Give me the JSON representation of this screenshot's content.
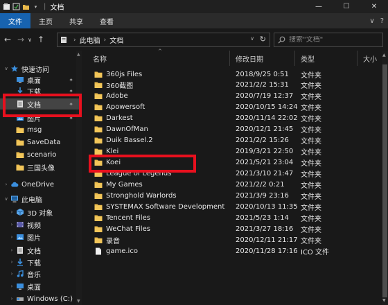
{
  "titlebar": {
    "title": "文档",
    "separator": "|",
    "controls": {
      "minimize": "—",
      "maximize": "☐",
      "close": "✕"
    }
  },
  "ribbon": {
    "tabs": [
      {
        "label": "文件",
        "active": true
      },
      {
        "label": "主页",
        "active": false
      },
      {
        "label": "共享",
        "active": false
      },
      {
        "label": "查看",
        "active": false
      }
    ],
    "expand_glyph": "∨",
    "help_glyph": "?"
  },
  "nav": {
    "back": "←",
    "forward": "→",
    "recent": "∨",
    "up": "↑",
    "breadcrumb": [
      "此电脑",
      "文档"
    ],
    "crumb_sep": "›",
    "dropdown": "∨",
    "refresh": "↻"
  },
  "search": {
    "placeholder": "搜索\"文档\""
  },
  "sidebar": {
    "items": [
      {
        "label": "快速访问",
        "icon": "star-icon",
        "chevron": "∨",
        "indent": 0,
        "pinned": false,
        "selected": false
      },
      {
        "label": "桌面",
        "icon": "desktop-icon",
        "chevron": "",
        "indent": 1,
        "pinned": true,
        "selected": false
      },
      {
        "label": "下载",
        "icon": "download-icon",
        "chevron": "",
        "indent": 1,
        "pinned": true,
        "selected": false
      },
      {
        "label": "文档",
        "icon": "document-icon",
        "chevron": "",
        "indent": 1,
        "pinned": true,
        "selected": true
      },
      {
        "label": "图片",
        "icon": "pictures-icon",
        "chevron": "",
        "indent": 1,
        "pinned": true,
        "selected": false
      },
      {
        "label": "msg",
        "icon": "folder-icon",
        "chevron": "",
        "indent": 1,
        "pinned": false,
        "selected": false
      },
      {
        "label": "SaveData",
        "icon": "folder-icon",
        "chevron": "",
        "indent": 1,
        "pinned": false,
        "selected": false
      },
      {
        "label": "scenario",
        "icon": "folder-icon",
        "chevron": "",
        "indent": 1,
        "pinned": false,
        "selected": false
      },
      {
        "label": "三国头像",
        "icon": "folder-icon",
        "chevron": "",
        "indent": 1,
        "pinned": false,
        "selected": false
      },
      {
        "label": "OneDrive",
        "icon": "cloud-icon",
        "chevron": "›",
        "indent": 0,
        "pinned": false,
        "selected": false
      },
      {
        "label": "此电脑",
        "icon": "computer-icon",
        "chevron": "∨",
        "indent": 0,
        "pinned": false,
        "selected": false
      },
      {
        "label": "3D 对象",
        "icon": "cube-icon",
        "chevron": "›",
        "indent": 1,
        "pinned": false,
        "selected": false
      },
      {
        "label": "视频",
        "icon": "video-icon",
        "chevron": "›",
        "indent": 1,
        "pinned": false,
        "selected": false
      },
      {
        "label": "图片",
        "icon": "pictures-icon",
        "chevron": "›",
        "indent": 1,
        "pinned": false,
        "selected": false
      },
      {
        "label": "文档",
        "icon": "document-icon",
        "chevron": "›",
        "indent": 1,
        "pinned": false,
        "selected": false
      },
      {
        "label": "下载",
        "icon": "download-icon",
        "chevron": "›",
        "indent": 1,
        "pinned": false,
        "selected": false
      },
      {
        "label": "音乐",
        "icon": "music-icon",
        "chevron": "›",
        "indent": 1,
        "pinned": false,
        "selected": false
      },
      {
        "label": "桌面",
        "icon": "desktop-icon",
        "chevron": "›",
        "indent": 1,
        "pinned": false,
        "selected": false
      },
      {
        "label": "Windows (C:)",
        "icon": "drive-icon",
        "chevron": "›",
        "indent": 1,
        "pinned": false,
        "selected": false
      }
    ]
  },
  "columns": {
    "name": "名称",
    "date": "修改日期",
    "type": "类型",
    "size": "大小"
  },
  "files": [
    {
      "name": "360js Files",
      "date": "2018/9/25 0:51",
      "type": "文件夹",
      "icon": "folder-icon"
    },
    {
      "name": "360截图",
      "date": "2021/2/2 15:31",
      "type": "文件夹",
      "icon": "folder-icon"
    },
    {
      "name": "Adobe",
      "date": "2020/7/19 12:37",
      "type": "文件夹",
      "icon": "folder-icon"
    },
    {
      "name": "Apowersoft",
      "date": "2020/10/15 14:24",
      "type": "文件夹",
      "icon": "folder-icon"
    },
    {
      "name": "Darkest",
      "date": "2020/11/14 22:02",
      "type": "文件夹",
      "icon": "folder-icon"
    },
    {
      "name": "DawnOfMan",
      "date": "2020/12/1 21:45",
      "type": "文件夹",
      "icon": "folder-icon"
    },
    {
      "name": "Duik Bassel.2",
      "date": "2021/2/2 15:26",
      "type": "文件夹",
      "icon": "folder-icon"
    },
    {
      "name": "Klei",
      "date": "2019/3/21 22:50",
      "type": "文件夹",
      "icon": "folder-icon"
    },
    {
      "name": "Koei",
      "date": "2021/5/21 23:04",
      "type": "文件夹",
      "icon": "folder-icon"
    },
    {
      "name": "League of Legends",
      "date": "2021/3/10 21:47",
      "type": "文件夹",
      "icon": "folder-icon"
    },
    {
      "name": "My Games",
      "date": "2021/2/2 0:21",
      "type": "文件夹",
      "icon": "folder-icon"
    },
    {
      "name": "Stronghold Warlords",
      "date": "2021/3/9 23:16",
      "type": "文件夹",
      "icon": "folder-icon"
    },
    {
      "name": "SYSTEMAX Software Development",
      "date": "2020/10/13 11:35",
      "type": "文件夹",
      "icon": "folder-icon"
    },
    {
      "name": "Tencent Files",
      "date": "2021/5/23 1:14",
      "type": "文件夹",
      "icon": "folder-icon"
    },
    {
      "name": "WeChat Files",
      "date": "2021/3/27 18:16",
      "type": "文件夹",
      "icon": "folder-icon"
    },
    {
      "name": "录音",
      "date": "2020/12/11 21:17",
      "type": "文件夹",
      "icon": "folder-icon"
    },
    {
      "name": "game.ico",
      "date": "2020/11/28 17:16",
      "type": "ICO 文件",
      "icon": "file-icon"
    }
  ],
  "colors": {
    "accent": "#1763b0",
    "highlight": "#e8101e",
    "folder": "#e8b84a"
  }
}
